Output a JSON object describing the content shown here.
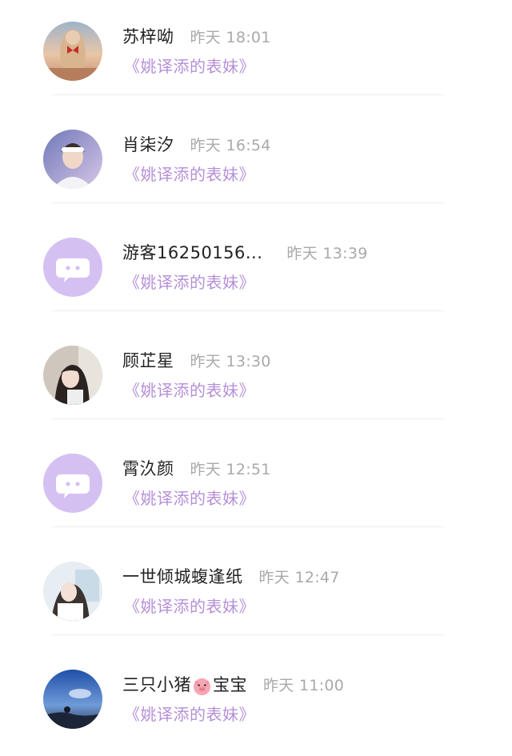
{
  "comments": [
    {
      "username": "苏梓呦",
      "time": "昨天 18:01",
      "source": "《姚译添的表妹》",
      "avatar": "photo-sunset-girl"
    },
    {
      "username": "肖柒汐",
      "time": "昨天 16:54",
      "source": "《姚译添的表妹》",
      "avatar": "photo-boy-headband"
    },
    {
      "username": "游客16250156...",
      "time": "昨天 13:39",
      "source": "《姚译添的表妹》",
      "avatar": "default-chat-bubble"
    },
    {
      "username": "顾芷星",
      "time": "昨天 13:30",
      "source": "《姚译添的表妹》",
      "avatar": "photo-girl-bangs"
    },
    {
      "username": "霄汣颜",
      "time": "昨天 12:51",
      "source": "《姚译添的表妹》",
      "avatar": "default-chat-bubble"
    },
    {
      "username": "一世倾城蝮逢纸",
      "time": "昨天 12:47",
      "source": "《姚译添的表妹》",
      "avatar": "photo-girl-white"
    },
    {
      "username_before": "三只小猪",
      "username_emoji": "pig-face-icon",
      "username_after": "宝宝",
      "time": "昨天 11:00",
      "source": "《姚译添的表妹》",
      "avatar": "photo-blue-sky"
    }
  ],
  "colors": {
    "name": "#222222",
    "time": "#a9a9a9",
    "source_link": "#b58fd9",
    "default_avatar_bg": "#d5c0f2",
    "divider": "#efefef"
  }
}
